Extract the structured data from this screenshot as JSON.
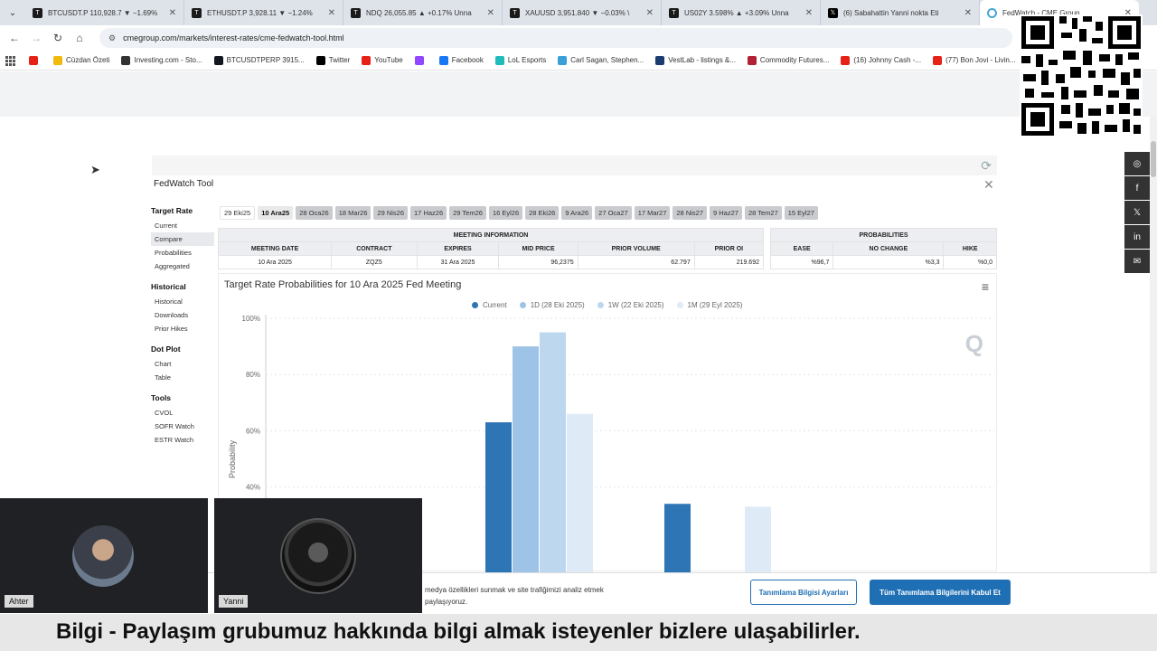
{
  "browser": {
    "tabs": [
      {
        "title": "BTCUSDT.P 110,928.7 ▼ −1.69%",
        "icon": "tradingview-icon",
        "active": false
      },
      {
        "title": "ETHUSDT.P 3,928.11 ▼ −1.24%",
        "icon": "tradingview-icon",
        "active": false
      },
      {
        "title": "NDQ 26,055.85 ▲ +0.17% Unna",
        "icon": "tradingview-icon",
        "active": false
      },
      {
        "title": "XAUUSD 3,951.840 ▼ −0.03% \\",
        "icon": "tradingview-icon",
        "active": false
      },
      {
        "title": "US02Y 3.598% ▲ +3.09% Unna",
        "icon": "tradingview-icon",
        "active": false
      },
      {
        "title": "(6) Sabahattin Yanni nokta Eti",
        "icon": "x-icon",
        "active": false
      },
      {
        "title": "FedWatch - CME Group",
        "icon": "cme-icon",
        "active": true
      }
    ],
    "url": "cmegroup.com/markets/interest-rates/cme-fedwatch-tool.html",
    "bookmarks": [
      {
        "label": "",
        "icon": "youtube-icon",
        "color": "#e62117"
      },
      {
        "label": "Cüzdan Özeti",
        "icon": "binance-icon",
        "color": "#f0b90b"
      },
      {
        "label": "Investing.com - Sto...",
        "icon": "investing-icon",
        "color": "#333"
      },
      {
        "label": "BTCUSDTPERP 3915...",
        "icon": "tradingview-icon",
        "color": "#131722"
      },
      {
        "label": "Twitter",
        "icon": "x-icon",
        "color": "#000"
      },
      {
        "label": "YouTube",
        "icon": "youtube-icon",
        "color": "#e62117"
      },
      {
        "label": "",
        "icon": "twitch-icon",
        "color": "#9146ff"
      },
      {
        "label": "Facebook",
        "icon": "facebook-icon",
        "color": "#1877f2"
      },
      {
        "label": "LoL Esports",
        "icon": "lol-icon",
        "color": "#2bb"
      },
      {
        "label": "Carl Sagan, Stephen...",
        "icon": "drop-icon",
        "color": "#3aa0d8"
      },
      {
        "label": "VestLab - listings &...",
        "icon": "vestlab-icon",
        "color": "#1a3c6e"
      },
      {
        "label": "Commodity Futures...",
        "icon": "flag-icon",
        "color": "#b22234"
      },
      {
        "label": "(16) Johnny Cash -...",
        "icon": "youtube-icon",
        "color": "#e62117"
      },
      {
        "label": "(77) Bon Jovi - Livin...",
        "icon": "youtube-icon",
        "color": "#e62117"
      }
    ]
  },
  "fedwatch": {
    "title": "FedWatch Tool",
    "sidebar": [
      {
        "heading": "Target Rate",
        "items": [
          "Current",
          "Compare",
          "Probabilities",
          "Aggregated"
        ]
      },
      {
        "heading": "Historical",
        "items": [
          "Historical",
          "Downloads",
          "Prior Hikes"
        ]
      },
      {
        "heading": "Dot Plot",
        "items": [
          "Chart",
          "Table"
        ]
      },
      {
        "heading": "Tools",
        "items": [
          "CVOL",
          "SOFR Watch",
          "ESTR Watch"
        ]
      }
    ],
    "active_sidebar_item": "Compare",
    "date_tabs": [
      "29 Eki25",
      "10 Ara25",
      "28 Oca26",
      "18 Mar26",
      "29 Nis26",
      "17 Haz26",
      "29 Tem26",
      "16 Eyl26",
      "28 Eki26",
      "9 Ara26",
      "27 Oca27",
      "17 Mar27",
      "28 Nis27",
      "9 Haz27",
      "28 Tem27",
      "15 Eyl27"
    ],
    "selected_date_tab": "10 Ara25",
    "meeting_info": {
      "group_header": "MEETING INFORMATION",
      "headers": [
        "MEETING DATE",
        "CONTRACT",
        "EXPIRES",
        "MID PRICE",
        "PRIOR VOLUME",
        "PRIOR OI"
      ],
      "row": [
        "10 Ara 2025",
        "ZQZ5",
        "31 Ara 2025",
        "96,2375",
        "62.797",
        "219.692"
      ]
    },
    "probabilities": {
      "group_header": "PROBABILITIES",
      "headers": [
        "EASE",
        "NO CHANGE",
        "HIKE"
      ],
      "row": [
        "%96,7",
        "%3,3",
        "%0,0"
      ]
    }
  },
  "chart_data": {
    "type": "bar",
    "title": "Target Rate Probabilities for 10 Ara 2025 Fed Meeting",
    "ylabel": "Probability",
    "ylim": [
      0,
      100
    ],
    "yticks": [
      "40%",
      "60%",
      "80%",
      "100%"
    ],
    "ytick_values": [
      40,
      60,
      80,
      100
    ],
    "series": [
      {
        "name": "Current",
        "color": "#2e75b6",
        "values": [
          63,
          34,
          null
        ]
      },
      {
        "name": "1D (28 Eki 2025)",
        "color": "#9dc3e6",
        "values": [
          90,
          null,
          null
        ]
      },
      {
        "name": "1W (22 Eki 2025)",
        "color": "#bdd7ee",
        "values": [
          95,
          null,
          null
        ]
      },
      {
        "name": "1M (29 Eyl 2025)",
        "color": "#deebf7",
        "values": [
          66,
          null,
          33
        ]
      }
    ],
    "grid": true,
    "legend_position": "top-center"
  },
  "cookie": {
    "text": "medya özellikleri sunmak ve site trafiğimizi analiz etmek paylaşıyoruz.",
    "settings_button": "Tanımlama Bilgisi Ayarları",
    "accept_button": "Tüm Tanımlama Bilgilerini Kabul Et"
  },
  "video": {
    "participants": [
      "Ahter",
      "Yanni"
    ]
  },
  "caption": "Bilgi - Paylaşım grubumuz hakkında bilgi almak isteyenler bizlere ulaşabilirler.",
  "share_icons": [
    "whatsapp-icon",
    "facebook-icon",
    "x-icon",
    "linkedin-icon",
    "mail-icon"
  ],
  "watermark_letter": "Q"
}
